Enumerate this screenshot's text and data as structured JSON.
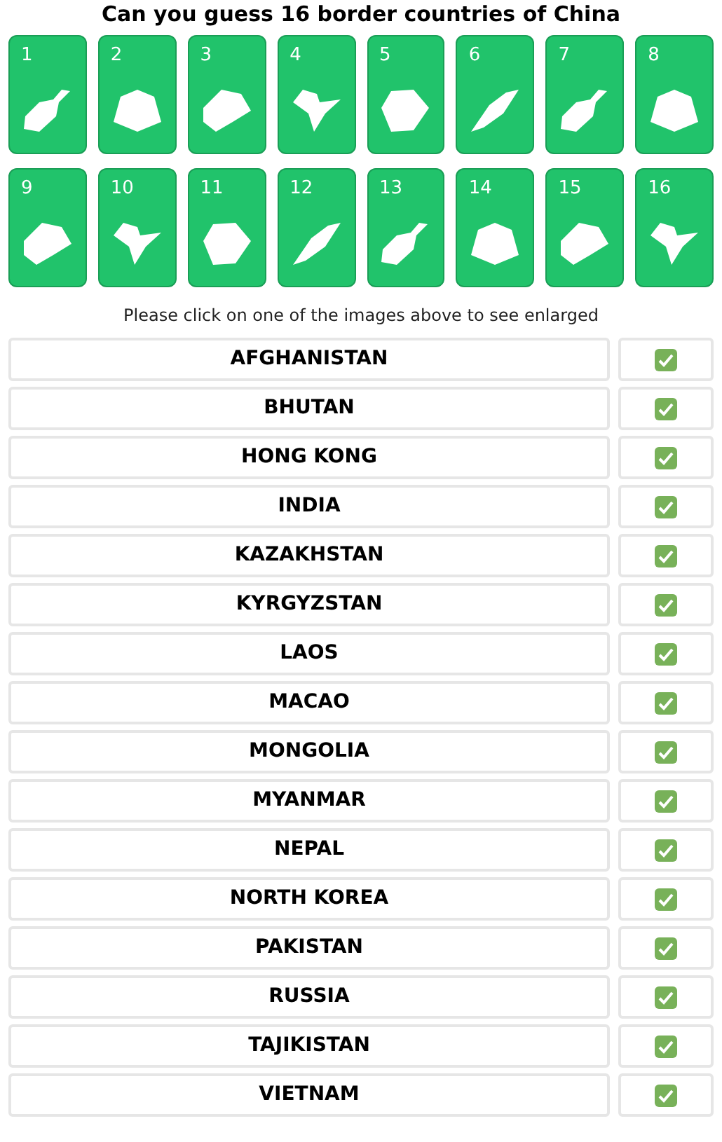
{
  "title": "Can you guess 16 border countries of China",
  "tiles": [
    {
      "number": "1"
    },
    {
      "number": "2"
    },
    {
      "number": "3"
    },
    {
      "number": "4"
    },
    {
      "number": "5"
    },
    {
      "number": "6"
    },
    {
      "number": "7"
    },
    {
      "number": "8"
    },
    {
      "number": "9"
    },
    {
      "number": "10"
    },
    {
      "number": "11"
    },
    {
      "number": "12"
    },
    {
      "number": "13"
    },
    {
      "number": "14"
    },
    {
      "number": "15"
    },
    {
      "number": "16"
    }
  ],
  "hint": "Please click on one of the images above to see enlarged",
  "answers": [
    {
      "name": "AFGHANISTAN",
      "checked": true
    },
    {
      "name": "BHUTAN",
      "checked": true
    },
    {
      "name": "HONG KONG",
      "checked": true
    },
    {
      "name": "INDIA",
      "checked": true
    },
    {
      "name": "KAZAKHSTAN",
      "checked": true
    },
    {
      "name": "KYRGYZSTAN",
      "checked": true
    },
    {
      "name": "LAOS",
      "checked": true
    },
    {
      "name": "MACAO",
      "checked": true
    },
    {
      "name": "MONGOLIA",
      "checked": true
    },
    {
      "name": "MYANMAR",
      "checked": true
    },
    {
      "name": "NEPAL",
      "checked": true
    },
    {
      "name": "NORTH KOREA",
      "checked": true
    },
    {
      "name": "PAKISTAN",
      "checked": true
    },
    {
      "name": "RUSSIA",
      "checked": true
    },
    {
      "name": "TAJIKISTAN",
      "checked": true
    },
    {
      "name": "VIETNAM",
      "checked": true
    }
  ]
}
